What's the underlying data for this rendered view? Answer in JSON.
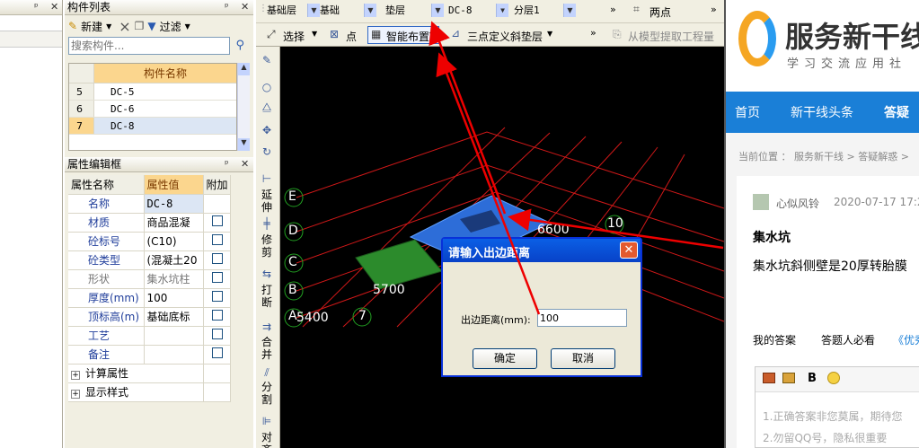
{
  "component_list": {
    "title": "构件列表",
    "new_label": "新建",
    "delete_icon": "×",
    "filter_label": "过滤",
    "search_placeholder": "搜索构件...",
    "col_header": "构件名称",
    "rows": [
      {
        "no": "5",
        "name": "DC-5"
      },
      {
        "no": "6",
        "name": "DC-6"
      },
      {
        "no": "7",
        "name": "DC-8"
      }
    ]
  },
  "property_editor": {
    "title": "属性编辑框",
    "headers": {
      "name": "属性名称",
      "value": "属性值",
      "extra": "附加"
    },
    "rows": [
      {
        "name": "名称",
        "value": "DC-8"
      },
      {
        "name": "材质",
        "value": "商品混凝"
      },
      {
        "name": "砼标号",
        "value": "(C10)"
      },
      {
        "name": "砼类型",
        "value": "(混凝土20"
      },
      {
        "name": "形状",
        "value": "集水坑柱"
      },
      {
        "name": "厚度(mm)",
        "value": "100"
      },
      {
        "name": "顶标高(m)",
        "value": "基础底标"
      },
      {
        "name": "工艺",
        "value": ""
      },
      {
        "name": "备注",
        "value": ""
      }
    ],
    "groups": [
      "计算属性",
      "显示样式"
    ]
  },
  "toolbar": {
    "floor": "基础层",
    "category": "基础",
    "type": "垫层",
    "component": "DC-8",
    "layer": "分层1",
    "two_point": "两点",
    "select": "选择",
    "point": "点",
    "smart_layout": "智能布置",
    "three_point": "三点定义斜垫层",
    "extract": "从模型提取工程量"
  },
  "vertical_tools": {
    "extend": "延伸",
    "modify": "修剪",
    "break": "打断",
    "merge": "合并",
    "split": "分割",
    "align": "对齐"
  },
  "canvas": {
    "axis_labels": [
      "E",
      "D",
      "C",
      "B",
      "A"
    ],
    "num_labels": [
      "10",
      "7"
    ],
    "dims": [
      "6600",
      "5700",
      "5400"
    ]
  },
  "dialog": {
    "title": "请输入出边距离",
    "field_label": "出边距离(mm):",
    "field_value": "100",
    "ok": "确定",
    "cancel": "取消"
  },
  "web": {
    "logo_name": "服务新干线",
    "logo_sub": "学习交流应用社",
    "nav": [
      "首页",
      "新干线头条",
      "答疑"
    ],
    "breadcrumb": [
      "当前位置 ：",
      "服务新干线",
      ">",
      "答疑解惑",
      ">"
    ],
    "author": "心似风铃",
    "date": "2020-07-17 17:2",
    "question_title": "集水坑",
    "question_body": "集水坑斜侧壁是20厚转胎膜",
    "tabs": [
      "我的答案",
      "答题人必看",
      "《优秀"
    ],
    "editor_hint1": "1.正确答案非您莫属，期待您",
    "editor_hint2": "2.勿留QQ号，隐私很重要"
  }
}
